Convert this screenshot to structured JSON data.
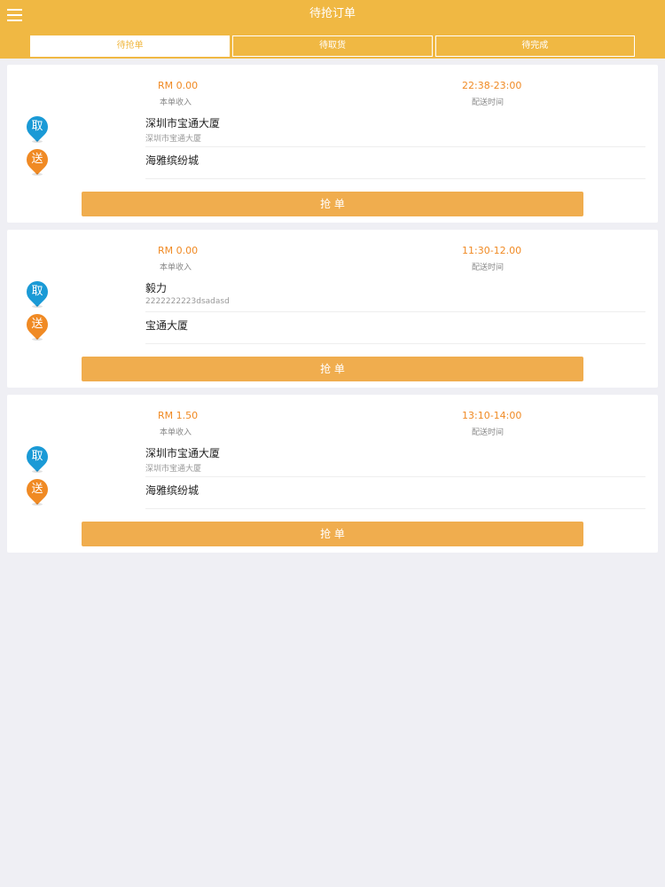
{
  "header": {
    "title": "待抢订单",
    "menu_icon": "hamburger-menu-icon"
  },
  "tabs": [
    {
      "label": "待抢单",
      "active": true
    },
    {
      "label": "待取货",
      "active": false
    },
    {
      "label": "待完成",
      "active": false
    }
  ],
  "orders": [
    {
      "income": "RM 0.00",
      "income_label": "本单收入",
      "time": "22:38-23:00",
      "time_label": "配送时间",
      "pickup_badge": "取",
      "dropoff_badge": "送",
      "pickup_name": "深圳市宝通大厦",
      "pickup_address": "深圳市宝通大厦",
      "dropoff_name": "海雅缤纷城",
      "button": "抢 单"
    },
    {
      "income": "RM 0.00",
      "income_label": "本单收入",
      "time": "11:30-12.00",
      "time_label": "配送时间",
      "pickup_badge": "取",
      "dropoff_badge": "送",
      "pickup_name": "毅力",
      "pickup_address": "2222222223dsadasd",
      "dropoff_name": "宝通大厦",
      "button": "抢 单"
    },
    {
      "income": "RM 1.50",
      "income_label": "本单收入",
      "time": "13:10-14:00",
      "time_label": "配送时间",
      "pickup_badge": "取",
      "dropoff_badge": "送",
      "pickup_name": "深圳市宝通大厦",
      "pickup_address": "深圳市宝通大厦",
      "dropoff_name": "海雅缤纷城",
      "button": "抢 单"
    }
  ],
  "colors": {
    "header": "#f0b843",
    "accent_orange": "#f08a24",
    "pickup_blue": "#1a9ad6",
    "button": "#f0ad4e",
    "background": "#efeff4"
  }
}
